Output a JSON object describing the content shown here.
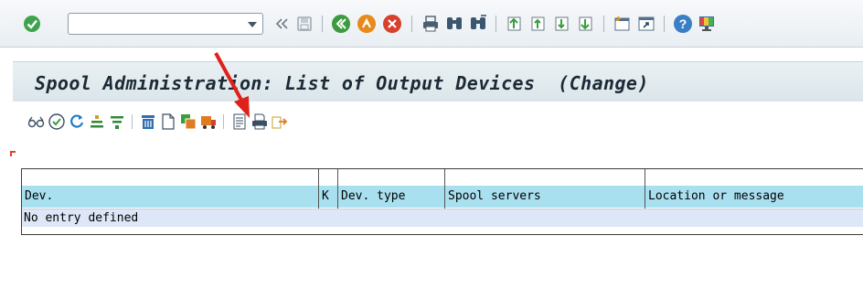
{
  "title": "Spool Administration: List of Output Devices  (Change)",
  "command_field": {
    "value": "",
    "placeholder": ""
  },
  "system_toolbar": {
    "icons": [
      "enter-icon",
      "back-nav-icon",
      "save-icon",
      "back-icon",
      "exit-icon",
      "cancel-icon",
      "print-icon",
      "find-icon",
      "find-next-icon",
      "first-page-icon",
      "previous-page-icon",
      "next-page-icon",
      "last-page-icon",
      "new-session-icon",
      "shortcut-icon",
      "help-icon",
      "customize-layout-icon"
    ]
  },
  "app_toolbar": {
    "icons": [
      "glasses-display-icon",
      "check-icon",
      "refresh-icon",
      "sort-ascending-icon",
      "filter-icon",
      "delete-icon",
      "create-icon",
      "copy-icon",
      "transport-icon",
      "details-icon",
      "print-preview-icon",
      "export-icon"
    ]
  },
  "table": {
    "columns": [
      "Dev.",
      "K",
      "Dev. type",
      "Spool servers",
      "Location or message"
    ],
    "rows": [],
    "empty_message": "No entry defined"
  },
  "colors": {
    "header_band": "#a9e0f0",
    "row_band": "#dde7f7",
    "annotation_arrow": "#e0201a"
  }
}
